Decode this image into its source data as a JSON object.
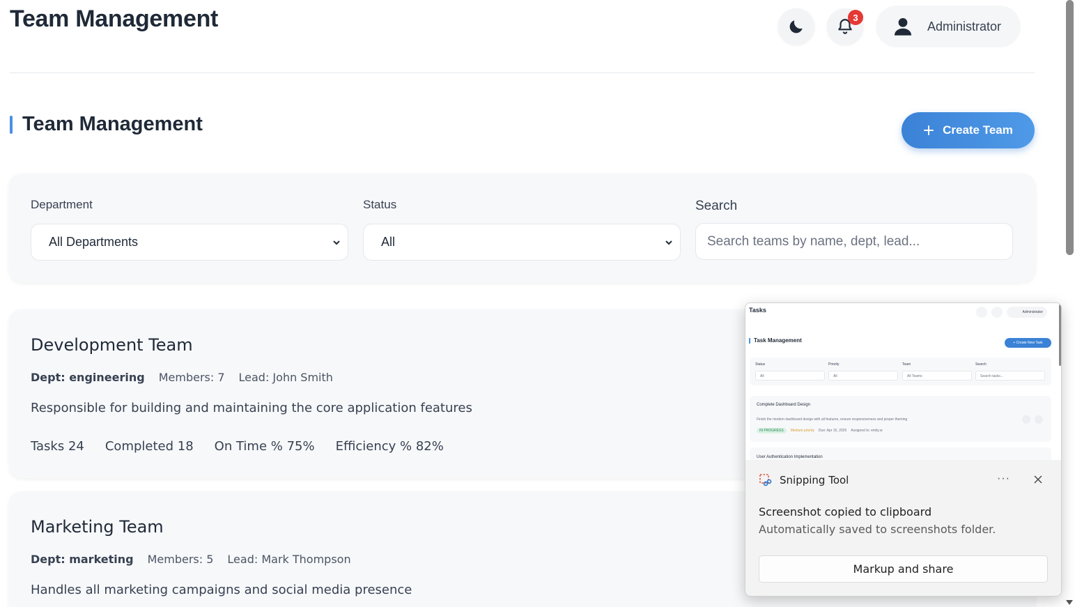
{
  "header": {
    "title": "Team Management",
    "notification_count": "3",
    "user_name": "Administrator"
  },
  "section": {
    "title": "Team Management",
    "create_button": "Create Team"
  },
  "filters": {
    "department_label": "Department",
    "department_value": "All Departments",
    "status_label": "Status",
    "status_value": "All",
    "search_label": "Search",
    "search_placeholder": "Search teams by name, dept, lead..."
  },
  "teams": [
    {
      "name": "Development Team",
      "dept": "Dept: engineering",
      "members": "Members: 7",
      "lead": "Lead: John Smith",
      "description": "Responsible for building and maintaining the core application features",
      "tasks": "Tasks 24",
      "completed": "Completed 18",
      "on_time": "On Time % 75%",
      "efficiency": "Efficiency % 82%"
    },
    {
      "name": "Marketing Team",
      "dept": "Dept: marketing",
      "members": "Members: 5",
      "lead": "Lead: Mark Thompson",
      "description": "Handles all marketing campaigns and social media presence"
    }
  ],
  "snipping_tool": {
    "app_name": "Snipping Tool",
    "message": "Screenshot copied to clipboard",
    "sub_message": "Automatically saved to screenshots folder.",
    "action_button": "Markup and share",
    "more_label": "···",
    "thumbnail": {
      "title": "Tasks",
      "user": "Administrator",
      "section_title": "Task Management",
      "create_button": "+ Create New Task",
      "filter_labels": [
        "Status",
        "Priority",
        "Team",
        "Search"
      ],
      "filter_values": [
        "All",
        "All",
        "All Teams",
        "Search tasks..."
      ],
      "task1_title": "Complete Dashboard Design",
      "task1_desc": "Finish the modern dashboard design with all features, ensure responsiveness and proper theming",
      "task1_status": "IN PROGRESS",
      "task1_priority": "Medium priority",
      "task1_due": "Due: Apr 15, 2025",
      "task1_assignee": "Assigned to: emily.w",
      "task2_title": "User Authentication Implementation"
    }
  },
  "colors": {
    "accent": "#3b82d6",
    "badge": "#e53935",
    "card_bg": "#f7f8fa"
  },
  "icons": [
    "moon-icon",
    "bell-icon",
    "user-icon",
    "plus-icon",
    "chevron-down-icon",
    "snipping-tool-icon",
    "close-icon"
  ]
}
